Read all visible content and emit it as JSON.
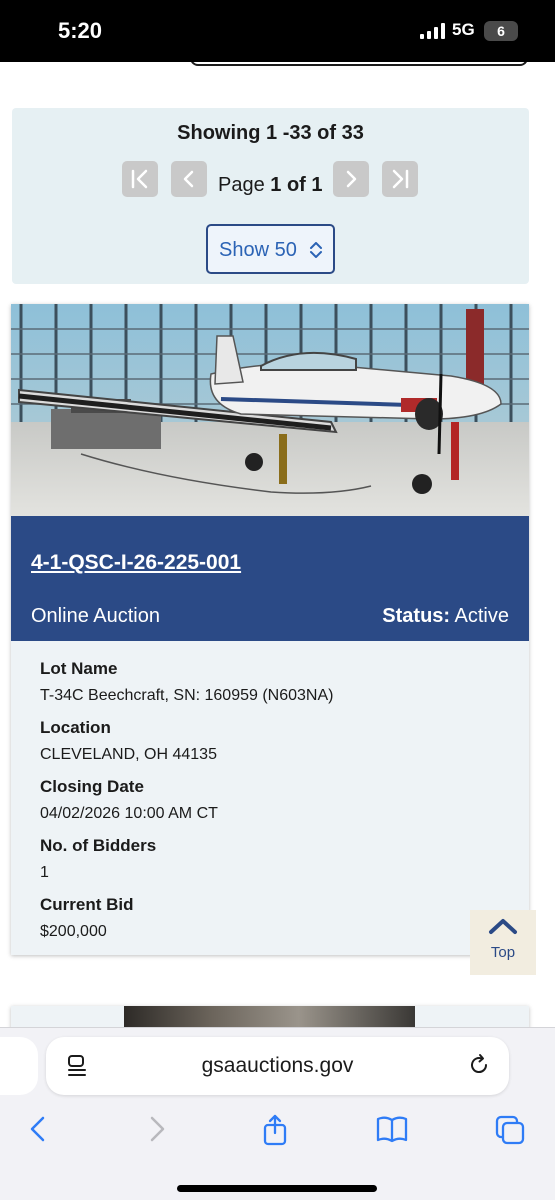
{
  "status_bar": {
    "time": "5:20",
    "network": "5G",
    "battery": "6"
  },
  "pager": {
    "showing": "Showing 1 -33  of 33",
    "page_prefix": "Page ",
    "page_current": "1 of 1",
    "page_size": "Show 50"
  },
  "listing": {
    "lot_number": "4-1-QSC-I-26-225-001",
    "auction_type": "Online Auction",
    "status_label": "Status:",
    "status_value": "Active",
    "fields": [
      {
        "label": "Lot Name",
        "value": "T-34C Beechcraft, SN: 160959 (N603NA)"
      },
      {
        "label": "Location",
        "value": "CLEVELAND, OH 44135"
      },
      {
        "label": "Closing Date",
        "value": "04/02/2026 10:00 AM CT"
      },
      {
        "label": "No. of Bidders",
        "value": "1"
      },
      {
        "label": "Current Bid",
        "value": "$200,000"
      }
    ]
  },
  "top_button": {
    "label": "Top"
  },
  "browser": {
    "url": "gsaauctions.gov"
  },
  "colors": {
    "brand_navy": "#2b4a86",
    "pager_bg": "#e6f0f3",
    "card_bg": "#eef3f6",
    "link_blue": "#2b63b5"
  }
}
